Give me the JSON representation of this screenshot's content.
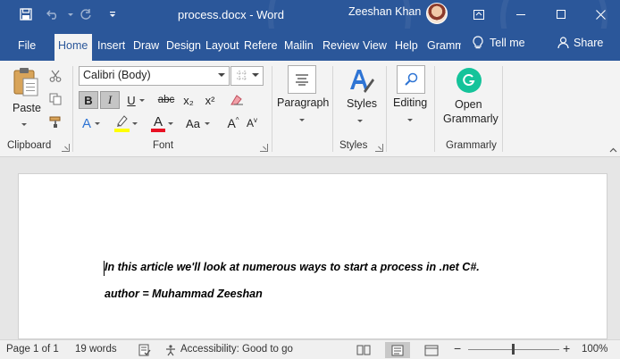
{
  "titlebar": {
    "title": "process.docx  -  Word",
    "user_name": "Zeeshan Khan"
  },
  "tabs": [
    {
      "label": "File"
    },
    {
      "label": "Home"
    },
    {
      "label": "Insert"
    },
    {
      "label": "Draw"
    },
    {
      "label": "Design"
    },
    {
      "label": "Layout"
    },
    {
      "label": "Referen"
    },
    {
      "label": "Mailin"
    },
    {
      "label": "Review"
    },
    {
      "label": "View"
    },
    {
      "label": "Help"
    },
    {
      "label": "Gramm"
    }
  ],
  "tell_me": "Tell me",
  "share": "Share",
  "ribbon": {
    "clipboard": {
      "paste_label": "Paste",
      "group_label": "Clipboard"
    },
    "font": {
      "font_name": "Calibri (Body)",
      "font_size": "",
      "group_label": "Font",
      "bold": "B",
      "italic": "I",
      "underline": "U",
      "strike": "abc",
      "subscript": "x₂",
      "superscript": "x²",
      "text_effects": "A",
      "font_color": "A",
      "change_case": "Aa",
      "grow": "A",
      "shrink": "A"
    },
    "paragraph": {
      "label": "Paragraph"
    },
    "styles": {
      "label": "Styles",
      "group_label": "Styles"
    },
    "editing": {
      "label": "Editing"
    },
    "grammarly": {
      "label_line1": "Open",
      "label_line2": "Grammarly",
      "group_label": "Grammarly"
    }
  },
  "document": {
    "line1": "In this article we'll look at numerous ways to start a process in .net C#.",
    "line2": "author = Muhammad Zeeshan"
  },
  "status": {
    "page": "Page 1 of 1",
    "words": "19 words",
    "accessibility": "Accessibility: Good to go",
    "zoom_minus": "−",
    "zoom_plus": "+",
    "zoom": "100%"
  },
  "colors": {
    "brand": "#2b579a",
    "highlight": "#ffff00",
    "font_color": "#e81123",
    "grammarly": "#15c39a"
  }
}
